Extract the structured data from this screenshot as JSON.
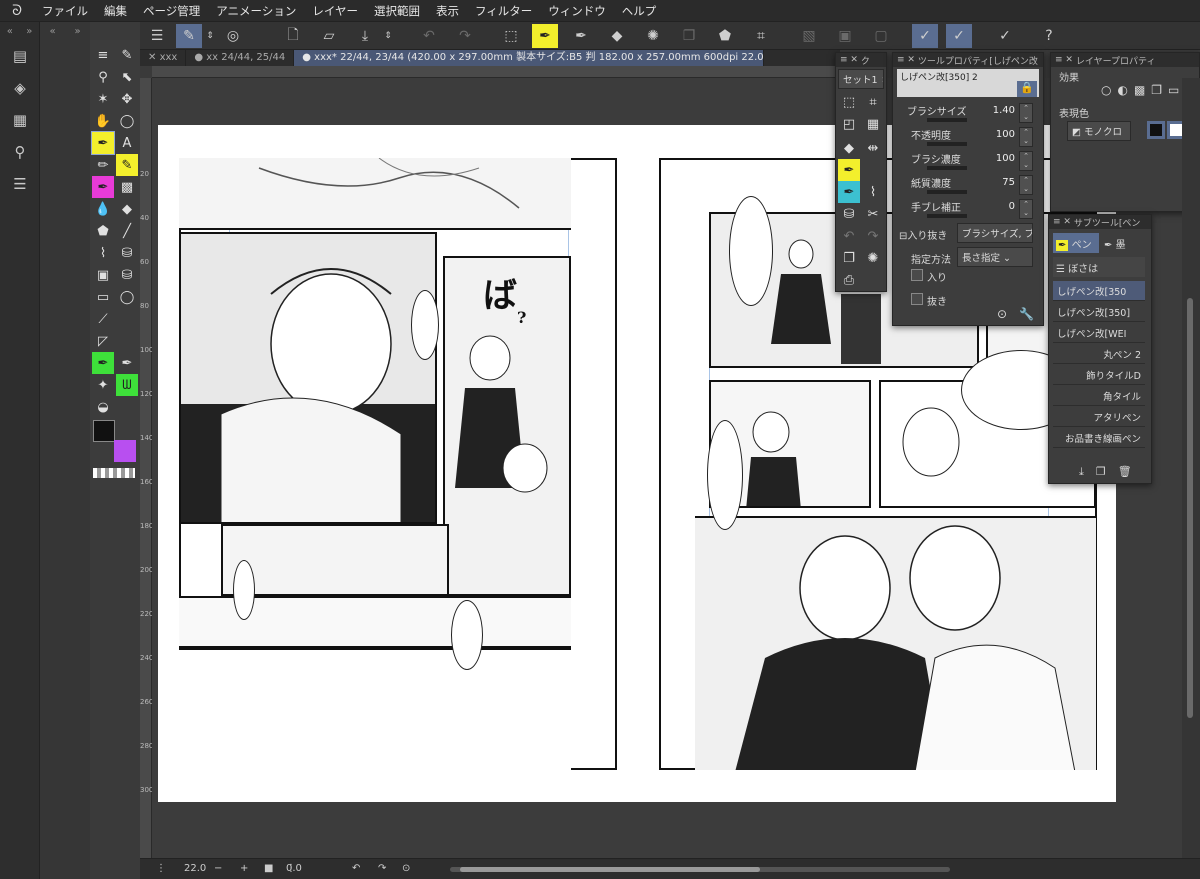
{
  "menu": {
    "items": [
      "ファイル",
      "編集",
      "ページ管理",
      "アニメーション",
      "レイヤー",
      "選択範囲",
      "表示",
      "フィルター",
      "ウィンドウ",
      "ヘルプ"
    ]
  },
  "tabs": [
    {
      "label": "xxx",
      "active": false
    },
    {
      "label": "xx 24/44, 25/44",
      "active": false
    },
    {
      "label": "xxx* 22/44, 23/44 (420.00 x 297.00mm 製本サイズ:B5 判 182.00 x 257.00mm 600dpi 22.0%)",
      "active": true
    }
  ],
  "canvas": {
    "sfx_text": "ば",
    "sfx_text_2": "?"
  },
  "ruler_left": [
    "20",
    "40",
    "60",
    "80",
    "100",
    "120",
    "140",
    "160",
    "180",
    "200",
    "220",
    "240",
    "260",
    "280",
    "300"
  ],
  "colors": {
    "main_color": "#111111",
    "sub_color": "#b84ff0",
    "accent": "#5a6d91",
    "yellow": "#f3ef2c",
    "magenta": "#e93bd8",
    "green": "#3ee03a"
  },
  "subtool_set": {
    "title": "セット1"
  },
  "tool_property": {
    "title": "ツールプロパティ[しげペン改",
    "brush_name": "しげペン改[350] 2",
    "rows": [
      {
        "label": "ブラシサイズ",
        "value": "1.40"
      },
      {
        "label": "不透明度",
        "value": "100"
      },
      {
        "label": "ブラシ濃度",
        "value": "100"
      },
      {
        "label": "紙質濃度",
        "value": "75"
      },
      {
        "label": "手ブレ補正",
        "value": "0"
      }
    ],
    "taper_label": "入り抜き",
    "taper_value": "ブラシサイズ, ブラシ",
    "method_label": "指定方法",
    "method_value": "長さ指定",
    "in_label": "入り",
    "out_label": "抜き"
  },
  "layer_property": {
    "title": "レイヤープロパティ",
    "effect_label": "効果",
    "expression_label": "表現色",
    "expression_value": "モノクロ"
  },
  "subtool": {
    "title": "サブツール[ペン",
    "tab_pen": "ペン",
    "tab_ink": "墨",
    "blur_label": "ぼさは",
    "brushes": [
      {
        "name": "しげペン改[350",
        "selected": true
      },
      {
        "name": "しげペン改[350]",
        "selected": false
      },
      {
        "name": "しげペン改[WEI",
        "selected": false
      },
      {
        "name": "丸ペン 2",
        "selected": false
      },
      {
        "name": "飾りタイルD",
        "selected": false
      },
      {
        "name": "角タイル",
        "selected": false
      },
      {
        "name": "アタリペン",
        "selected": false
      },
      {
        "name": "お品書き線画ペン",
        "selected": false
      }
    ]
  },
  "bottom": {
    "zoom": "22.0",
    "angle": "0.0"
  }
}
